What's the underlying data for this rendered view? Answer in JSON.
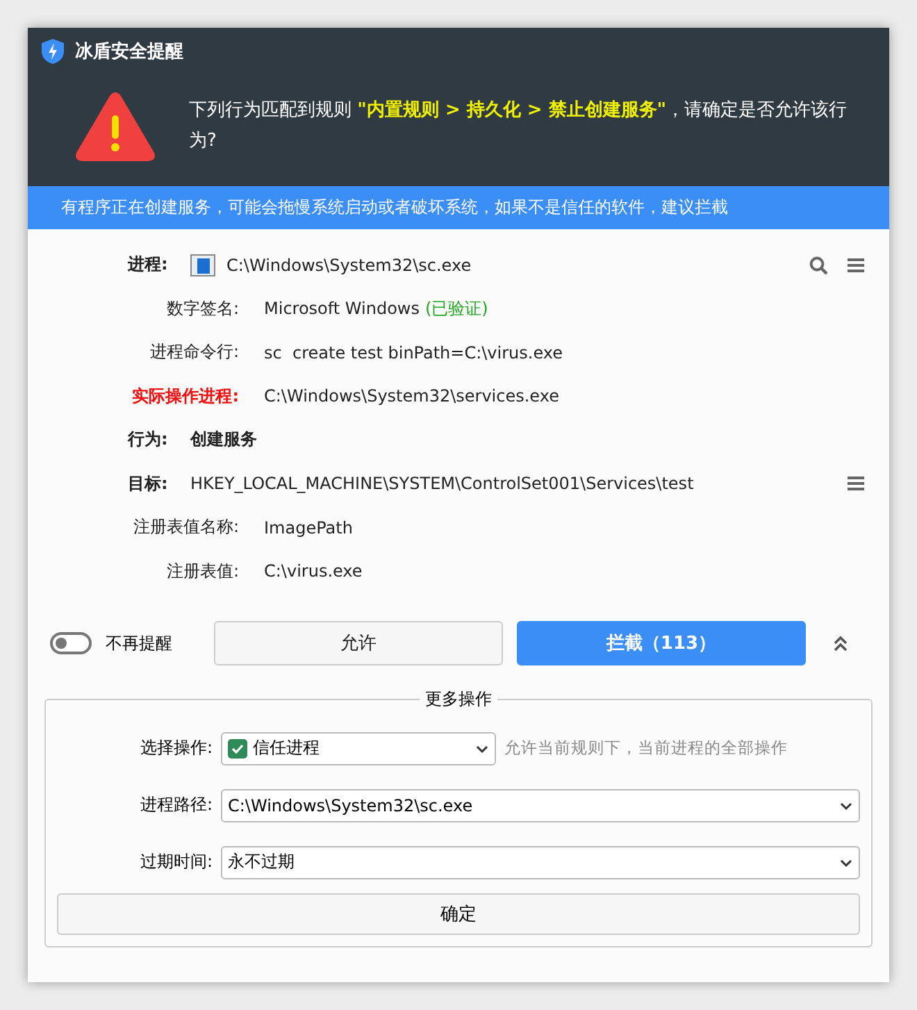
{
  "window": {
    "title": "冰盾安全提醒"
  },
  "alert": {
    "message": "下列行为匹配到规则 **\"内置规则 > 持久化 > 禁止创建服务\"**，请确定是否允许该行为?"
  },
  "banner": "有程序正在创建服务，可能会拖慢系统启动或者破坏系统，如果不是信任的软件，建议拦截",
  "details": [
    {
      "kind": "main",
      "label": "进程:",
      "value": "C:\\Windows\\System32\\sc.exe",
      "app_icon": true,
      "search": true,
      "menu": true
    },
    {
      "kind": "sub",
      "label": "数字签名:",
      "value": "Microsoft Windows",
      "note": "(已验证)"
    },
    {
      "kind": "sub",
      "label": "进程命令行:",
      "value": "sc  create test binPath=C:\\virus.exe"
    },
    {
      "kind": "alert",
      "label": "实际操作进程:",
      "value": "C:\\Windows\\System32\\services.exe"
    },
    {
      "kind": "main",
      "label": "行为:",
      "value": "创建服务",
      "bold": true
    },
    {
      "kind": "main",
      "label": "目标:",
      "value": "HKEY_LOCAL_MACHINE\\SYSTEM\\ControlSet001\\Services\\test",
      "menu": true
    },
    {
      "kind": "sub",
      "label": "注册表值名称:",
      "value": "ImagePath"
    },
    {
      "kind": "sub",
      "label": "注册表值:",
      "value": "C:\\virus.exe"
    }
  ],
  "do_not_remind": {
    "label": "不再提醒",
    "on": false
  },
  "buttons": [
    {
      "label": "允许",
      "kind": "secondary"
    },
    {
      "label": "拦截（113）",
      "kind": "primary"
    }
  ],
  "more_expanded": true,
  "more_actions": {
    "title": "更多操作",
    "fields": [
      {
        "label": "选择操作:",
        "value": "信任进程",
        "checked": true,
        "hint": "允许当前规则下，当前进程的全部操作"
      },
      {
        "label": "进程路径:",
        "value": "C:\\Windows\\System32\\sc.exe"
      },
      {
        "label": "过期时间:",
        "value": "永不过期"
      }
    ],
    "confirm": "确定"
  }
}
